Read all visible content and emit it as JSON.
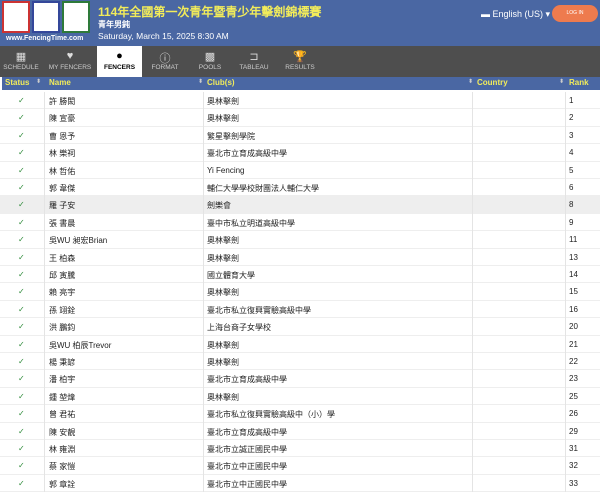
{
  "header": {
    "title": "114年全國第一次青年暨青少年擊劍錦標賽",
    "event": "青年男鈍",
    "date": "Saturday, March 15, 2025 8:30 AM",
    "logo_text": "www.FencingTime.com",
    "language": "English (US)",
    "login": "LOG IN"
  },
  "tabs": [
    {
      "label": "SCHEDULE",
      "icon": "calendar-icon"
    },
    {
      "label": "MY FENCERS",
      "icon": "heart-icon"
    },
    {
      "label": "FENCERS",
      "icon": "person-icon"
    },
    {
      "label": "FORMAT",
      "icon": "info-icon"
    },
    {
      "label": "POOLS",
      "icon": "grid-icon"
    },
    {
      "label": "TABLEAU",
      "icon": "bracket-icon"
    },
    {
      "label": "RESULTS",
      "icon": "trophy-icon"
    }
  ],
  "columns": {
    "status": "Status",
    "name": "Name",
    "club": "Club(s)",
    "country": "Country",
    "rank": "Rank"
  },
  "rows": [
    {
      "name": "許 勝閎",
      "club": "奧林擊劍",
      "rank": "1"
    },
    {
      "name": "陳 宣豪",
      "club": "奧林擊劍",
      "rank": "2"
    },
    {
      "name": "曹 恩予",
      "club": "繁星擊劍學院",
      "rank": "3"
    },
    {
      "name": "林 樂祠",
      "club": "臺北市立育成高級中學",
      "rank": "4"
    },
    {
      "name": "林 哲佑",
      "club": "Yi Fencing",
      "rank": "5"
    },
    {
      "name": "郭 韋傑",
      "club": "輔仁大學學校財團法人輔仁大學",
      "rank": "6"
    },
    {
      "name": "羅 子安",
      "club": "劍樂會",
      "rank": "8"
    },
    {
      "name": "張 書晨",
      "club": "臺中市私立明道高級中學",
      "rank": "9"
    },
    {
      "name": "吳WU 昶宏Brian",
      "club": "奧林擊劍",
      "rank": "11"
    },
    {
      "name": "王 柏森",
      "club": "奧林擊劍",
      "rank": "13"
    },
    {
      "name": "邱 寅騰",
      "club": "國立體育大學",
      "rank": "14"
    },
    {
      "name": "賴 亮宇",
      "club": "奧林擊劍",
      "rank": "15"
    },
    {
      "name": "孫 翊銓",
      "club": "臺北市私立復興實驗高級中學",
      "rank": "16"
    },
    {
      "name": "洪 鵬鈞",
      "club": "上海台商子女學校",
      "rank": "20"
    },
    {
      "name": "吳WU 柏辰Trevor",
      "club": "奧林擊劍",
      "rank": "21"
    },
    {
      "name": "楊 秉諺",
      "club": "奧林擊劍",
      "rank": "22"
    },
    {
      "name": "潘 柏宇",
      "club": "臺北市立育成高級中學",
      "rank": "23"
    },
    {
      "name": "鍾 堃煒",
      "club": "奧林擊劍",
      "rank": "25"
    },
    {
      "name": "曾 君祐",
      "club": "臺北市私立復興實驗高級中（小）學",
      "rank": "26"
    },
    {
      "name": "陳 安靚",
      "club": "臺北市立育成高級中學",
      "rank": "29"
    },
    {
      "name": "林 雍淵",
      "club": "臺北市立誠正國民中學",
      "rank": "31"
    },
    {
      "name": "蔡 家愷",
      "club": "臺北市立中正國民中學",
      "rank": "32"
    },
    {
      "name": "郭 章詮",
      "club": "臺北市立中正國民中學",
      "rank": "33"
    }
  ],
  "highlight_row": 6,
  "colors": {
    "header": "#4a67a3",
    "accent": "#f2ec5a",
    "login": "#ee7b4e",
    "check": "#2e8b3a"
  }
}
